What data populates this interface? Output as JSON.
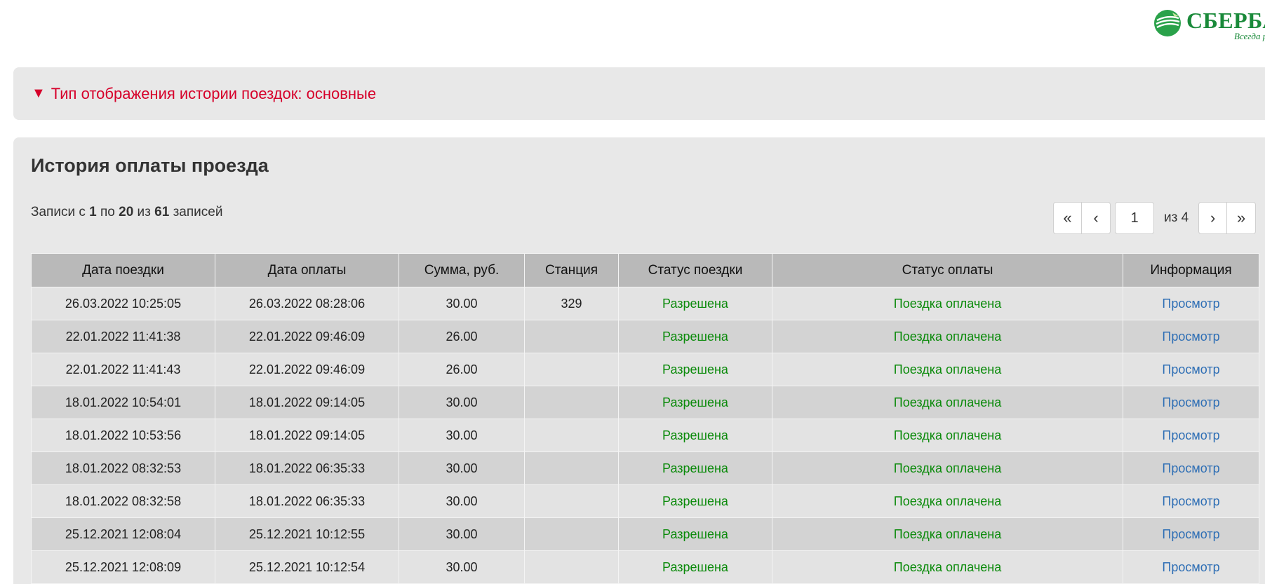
{
  "logo": {
    "name": "СБЕРБАН",
    "slogan": "Всегда р",
    "colors": {
      "brand": "#1a8a3a"
    }
  },
  "display_toggle": {
    "triangle": "▼",
    "label": "Тип отображения истории поездок: основные",
    "color": "#d6002a"
  },
  "history": {
    "title": "История оплаты проезда",
    "records_info": {
      "prefix": "Записи с",
      "from": "1",
      "by": "по",
      "to": "20",
      "of": "из",
      "total": "61",
      "suffix": "записей"
    },
    "pager": {
      "first": "«",
      "prev": "‹",
      "current": "1",
      "of_label": "из 4",
      "next": "›",
      "last": "»"
    },
    "columns": [
      "Дата поездки",
      "Дата оплаты",
      "Сумма, руб.",
      "Станция",
      "Статус поездки",
      "Статус оплаты",
      "Информация"
    ],
    "rows": [
      {
        "trip_date": "26.03.2022 10:25:05",
        "pay_date": "26.03.2022 08:28:06",
        "amount": "30.00",
        "station": "329",
        "trip_status": "Разрешена",
        "pay_status": "Поездка оплачена",
        "info": "Просмотр"
      },
      {
        "trip_date": "22.01.2022 11:41:38",
        "pay_date": "22.01.2022 09:46:09",
        "amount": "26.00",
        "station": "",
        "trip_status": "Разрешена",
        "pay_status": "Поездка оплачена",
        "info": "Просмотр"
      },
      {
        "trip_date": "22.01.2022 11:41:43",
        "pay_date": "22.01.2022 09:46:09",
        "amount": "26.00",
        "station": "",
        "trip_status": "Разрешена",
        "pay_status": "Поездка оплачена",
        "info": "Просмотр"
      },
      {
        "trip_date": "18.01.2022 10:54:01",
        "pay_date": "18.01.2022 09:14:05",
        "amount": "30.00",
        "station": "",
        "trip_status": "Разрешена",
        "pay_status": "Поездка оплачена",
        "info": "Просмотр"
      },
      {
        "trip_date": "18.01.2022 10:53:56",
        "pay_date": "18.01.2022 09:14:05",
        "amount": "30.00",
        "station": "",
        "trip_status": "Разрешена",
        "pay_status": "Поездка оплачена",
        "info": "Просмотр"
      },
      {
        "trip_date": "18.01.2022 08:32:53",
        "pay_date": "18.01.2022 06:35:33",
        "amount": "30.00",
        "station": "",
        "trip_status": "Разрешена",
        "pay_status": "Поездка оплачена",
        "info": "Просмотр"
      },
      {
        "trip_date": "18.01.2022 08:32:58",
        "pay_date": "18.01.2022 06:35:33",
        "amount": "30.00",
        "station": "",
        "trip_status": "Разрешена",
        "pay_status": "Поездка оплачена",
        "info": "Просмотр"
      },
      {
        "trip_date": "25.12.2021 12:08:04",
        "pay_date": "25.12.2021 10:12:55",
        "amount": "30.00",
        "station": "",
        "trip_status": "Разрешена",
        "pay_status": "Поездка оплачена",
        "info": "Просмотр"
      },
      {
        "trip_date": "25.12.2021 12:08:09",
        "pay_date": "25.12.2021 10:12:54",
        "amount": "30.00",
        "station": "",
        "trip_status": "Разрешена",
        "pay_status": "Поездка оплачена",
        "info": "Просмотр"
      }
    ],
    "colors": {
      "status_ok": "#0a8a0a",
      "link": "#2f6fb5",
      "header_bg": "#b9b9b9"
    }
  }
}
